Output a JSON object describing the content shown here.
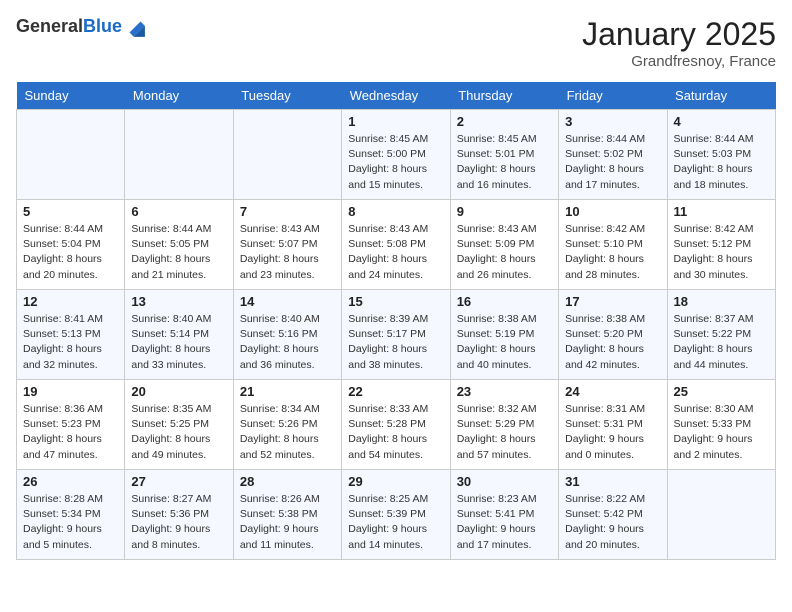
{
  "header": {
    "logo_general": "General",
    "logo_blue": "Blue",
    "month_title": "January 2025",
    "location": "Grandfresnoy, France"
  },
  "weekdays": [
    "Sunday",
    "Monday",
    "Tuesday",
    "Wednesday",
    "Thursday",
    "Friday",
    "Saturday"
  ],
  "weeks": [
    [
      {
        "day": "",
        "sunrise": "",
        "sunset": "",
        "daylight": ""
      },
      {
        "day": "",
        "sunrise": "",
        "sunset": "",
        "daylight": ""
      },
      {
        "day": "",
        "sunrise": "",
        "sunset": "",
        "daylight": ""
      },
      {
        "day": "1",
        "sunrise": "Sunrise: 8:45 AM",
        "sunset": "Sunset: 5:00 PM",
        "daylight": "Daylight: 8 hours and 15 minutes."
      },
      {
        "day": "2",
        "sunrise": "Sunrise: 8:45 AM",
        "sunset": "Sunset: 5:01 PM",
        "daylight": "Daylight: 8 hours and 16 minutes."
      },
      {
        "day": "3",
        "sunrise": "Sunrise: 8:44 AM",
        "sunset": "Sunset: 5:02 PM",
        "daylight": "Daylight: 8 hours and 17 minutes."
      },
      {
        "day": "4",
        "sunrise": "Sunrise: 8:44 AM",
        "sunset": "Sunset: 5:03 PM",
        "daylight": "Daylight: 8 hours and 18 minutes."
      }
    ],
    [
      {
        "day": "5",
        "sunrise": "Sunrise: 8:44 AM",
        "sunset": "Sunset: 5:04 PM",
        "daylight": "Daylight: 8 hours and 20 minutes."
      },
      {
        "day": "6",
        "sunrise": "Sunrise: 8:44 AM",
        "sunset": "Sunset: 5:05 PM",
        "daylight": "Daylight: 8 hours and 21 minutes."
      },
      {
        "day": "7",
        "sunrise": "Sunrise: 8:43 AM",
        "sunset": "Sunset: 5:07 PM",
        "daylight": "Daylight: 8 hours and 23 minutes."
      },
      {
        "day": "8",
        "sunrise": "Sunrise: 8:43 AM",
        "sunset": "Sunset: 5:08 PM",
        "daylight": "Daylight: 8 hours and 24 minutes."
      },
      {
        "day": "9",
        "sunrise": "Sunrise: 8:43 AM",
        "sunset": "Sunset: 5:09 PM",
        "daylight": "Daylight: 8 hours and 26 minutes."
      },
      {
        "day": "10",
        "sunrise": "Sunrise: 8:42 AM",
        "sunset": "Sunset: 5:10 PM",
        "daylight": "Daylight: 8 hours and 28 minutes."
      },
      {
        "day": "11",
        "sunrise": "Sunrise: 8:42 AM",
        "sunset": "Sunset: 5:12 PM",
        "daylight": "Daylight: 8 hours and 30 minutes."
      }
    ],
    [
      {
        "day": "12",
        "sunrise": "Sunrise: 8:41 AM",
        "sunset": "Sunset: 5:13 PM",
        "daylight": "Daylight: 8 hours and 32 minutes."
      },
      {
        "day": "13",
        "sunrise": "Sunrise: 8:40 AM",
        "sunset": "Sunset: 5:14 PM",
        "daylight": "Daylight: 8 hours and 33 minutes."
      },
      {
        "day": "14",
        "sunrise": "Sunrise: 8:40 AM",
        "sunset": "Sunset: 5:16 PM",
        "daylight": "Daylight: 8 hours and 36 minutes."
      },
      {
        "day": "15",
        "sunrise": "Sunrise: 8:39 AM",
        "sunset": "Sunset: 5:17 PM",
        "daylight": "Daylight: 8 hours and 38 minutes."
      },
      {
        "day": "16",
        "sunrise": "Sunrise: 8:38 AM",
        "sunset": "Sunset: 5:19 PM",
        "daylight": "Daylight: 8 hours and 40 minutes."
      },
      {
        "day": "17",
        "sunrise": "Sunrise: 8:38 AM",
        "sunset": "Sunset: 5:20 PM",
        "daylight": "Daylight: 8 hours and 42 minutes."
      },
      {
        "day": "18",
        "sunrise": "Sunrise: 8:37 AM",
        "sunset": "Sunset: 5:22 PM",
        "daylight": "Daylight: 8 hours and 44 minutes."
      }
    ],
    [
      {
        "day": "19",
        "sunrise": "Sunrise: 8:36 AM",
        "sunset": "Sunset: 5:23 PM",
        "daylight": "Daylight: 8 hours and 47 minutes."
      },
      {
        "day": "20",
        "sunrise": "Sunrise: 8:35 AM",
        "sunset": "Sunset: 5:25 PM",
        "daylight": "Daylight: 8 hours and 49 minutes."
      },
      {
        "day": "21",
        "sunrise": "Sunrise: 8:34 AM",
        "sunset": "Sunset: 5:26 PM",
        "daylight": "Daylight: 8 hours and 52 minutes."
      },
      {
        "day": "22",
        "sunrise": "Sunrise: 8:33 AM",
        "sunset": "Sunset: 5:28 PM",
        "daylight": "Daylight: 8 hours and 54 minutes."
      },
      {
        "day": "23",
        "sunrise": "Sunrise: 8:32 AM",
        "sunset": "Sunset: 5:29 PM",
        "daylight": "Daylight: 8 hours and 57 minutes."
      },
      {
        "day": "24",
        "sunrise": "Sunrise: 8:31 AM",
        "sunset": "Sunset: 5:31 PM",
        "daylight": "Daylight: 9 hours and 0 minutes."
      },
      {
        "day": "25",
        "sunrise": "Sunrise: 8:30 AM",
        "sunset": "Sunset: 5:33 PM",
        "daylight": "Daylight: 9 hours and 2 minutes."
      }
    ],
    [
      {
        "day": "26",
        "sunrise": "Sunrise: 8:28 AM",
        "sunset": "Sunset: 5:34 PM",
        "daylight": "Daylight: 9 hours and 5 minutes."
      },
      {
        "day": "27",
        "sunrise": "Sunrise: 8:27 AM",
        "sunset": "Sunset: 5:36 PM",
        "daylight": "Daylight: 9 hours and 8 minutes."
      },
      {
        "day": "28",
        "sunrise": "Sunrise: 8:26 AM",
        "sunset": "Sunset: 5:38 PM",
        "daylight": "Daylight: 9 hours and 11 minutes."
      },
      {
        "day": "29",
        "sunrise": "Sunrise: 8:25 AM",
        "sunset": "Sunset: 5:39 PM",
        "daylight": "Daylight: 9 hours and 14 minutes."
      },
      {
        "day": "30",
        "sunrise": "Sunrise: 8:23 AM",
        "sunset": "Sunset: 5:41 PM",
        "daylight": "Daylight: 9 hours and 17 minutes."
      },
      {
        "day": "31",
        "sunrise": "Sunrise: 8:22 AM",
        "sunset": "Sunset: 5:42 PM",
        "daylight": "Daylight: 9 hours and 20 minutes."
      },
      {
        "day": "",
        "sunrise": "",
        "sunset": "",
        "daylight": ""
      }
    ]
  ]
}
